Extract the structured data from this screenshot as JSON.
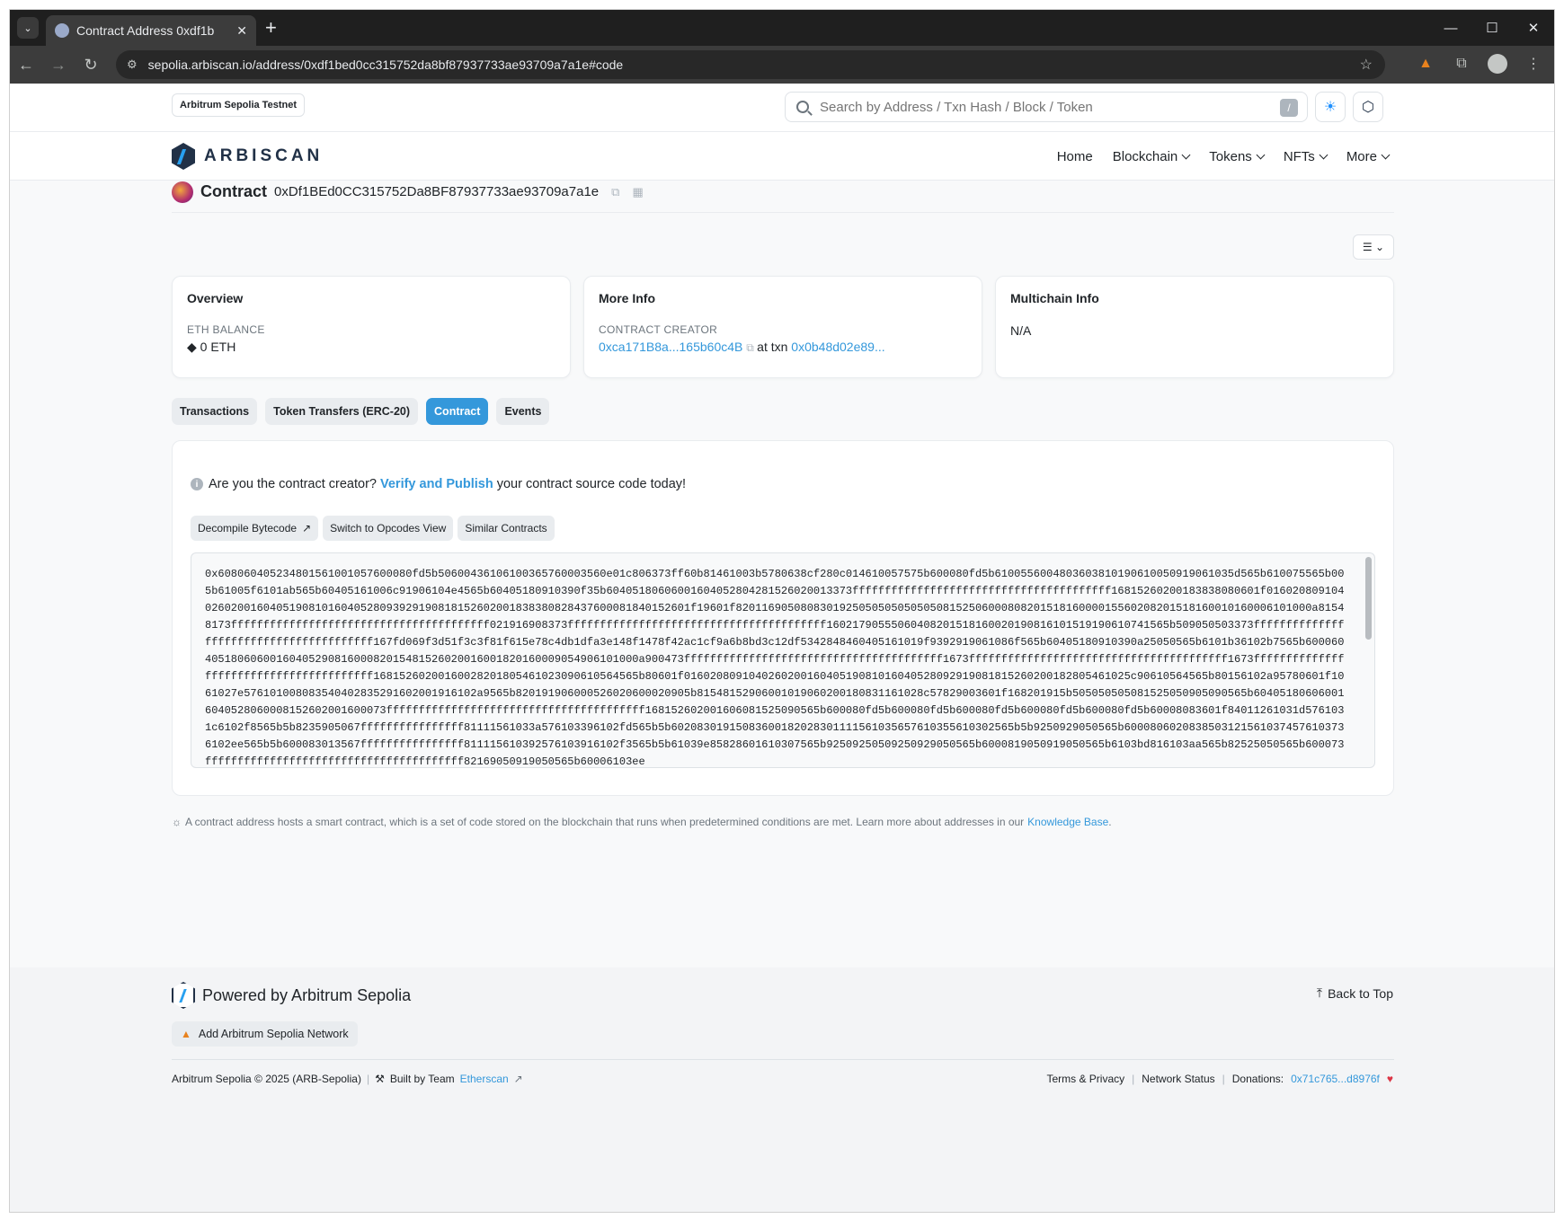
{
  "browser": {
    "tab_title": "Contract Address 0xdf1b",
    "url": "sepolia.arbiscan.io/address/0xdf1bed0cc315752da8bf87937733ae93709a7a1e#code"
  },
  "topbar": {
    "network_badge": "Arbitrum Sepolia Testnet",
    "search_placeholder": "Search by Address / Txn Hash / Block / Token",
    "search_shortcut": "/"
  },
  "nav": {
    "logo_text": "ARBISCAN",
    "items": [
      "Home",
      "Blockchain",
      "Tokens",
      "NFTs",
      "More"
    ]
  },
  "address": {
    "label": "Contract",
    "value": "0xDf1BEd0CC315752Da8BF87937733ae93709a7a1e"
  },
  "cards": {
    "overview": {
      "title": "Overview",
      "balance_label": "ETH BALANCE",
      "balance_value": "0 ETH"
    },
    "more_info": {
      "title": "More Info",
      "creator_label": "CONTRACT CREATOR",
      "creator": "0xca171B8a...165b60c4B",
      "at_txn": "at txn",
      "txn": "0x0b48d02e89..."
    },
    "multichain": {
      "title": "Multichain Info",
      "value": "N/A"
    }
  },
  "tabs": [
    "Transactions",
    "Token Transfers (ERC-20)",
    "Contract",
    "Events"
  ],
  "active_tab": "Contract",
  "notice": {
    "prefix": "Are you the contract creator?",
    "link": "Verify and Publish",
    "suffix": "your contract source code today!"
  },
  "tools": {
    "decompile": "Decompile Bytecode",
    "opcodes": "Switch to Opcodes View",
    "similar": "Similar Contracts"
  },
  "bytecode": "0x608060405234801561001057600080fd5b5060043610610036576000356 0e01c806373ff60b81461003b5780638cf280c014610057575b600080fd5b6100556004803603810190610050919061035d565b610075565b005b61005f6101ab565b60405161006c91906104e4565b60405180910390f35b6040518060600160405280428152602001337 3ffffffffffffffffffffffffffffffffffffffff16815260200183838080601f016020809104026020016040519081016040528093929190818152602001838380828437600081840152601f19601f820116905080830192505050505050508152506000808201518160000155602082015181600101600061010 00a81548173ffffffffffffffffffffffffffffffffffffffff021916908373ffffffffffffffffffffffffffffffffffffffff16021790555060408201518160020190816101519190610741565b509050503373ffffffffffffffffffffffffffffffffffffffff167fd069f3d51f3c3f81f615e78c4db1dfa3e148f1478f42ac1cf9a6b8bd3c12df534284846040516 1019f9392919061086f565b60405180910390a25050565b6101b36102b7565b60006040518060600160405290816000820154815260200160018201600090549061010 00a900473ffffffffffffffffffffffffffffffffffffffff1673ffffffffffffffffffffffffffffffffffffffff1673ffffffffffffffffffffffffffffffffffffffff16815260200160028201805461023090610564565b80601f016020809104026020016040519081016040528092919081815260200182805461025c90610564565b80156102a95780601f1061027e5761010080835404028352916020019161 02a9565b820191906000526020600020905b815481529060010190602001808311610 28c57829003601f168201915b505050505081525050905090565b6040518060600160405280600081526020016000 73ffffffffffffffffffffffffffffffffffffffff168152602001606081525090565b600080fd5b600080fd5b600080fd5b600080fd5b600080fd5b60008083601f840112610 31d5761031c6102f8565b5b8235905067ffffffffffffffff81111561033a5761033961 02fd565b5b60208301915083600182028301111561035657610355610302565b5b9250929050565b60008060208385031215610374576103736102ee565b5b600083013567ffffffffffffffff8111156103925761039161 02f3565b5b61039e85828601610307565b9250925050925092905056 5b60008190509190505 65b6103bd816103aa565b82525050565b600073ffffffffffffffffffffffffffffffffffffffff82169050919050565b60006103ee",
  "footnote": {
    "text": "A contract address hosts a smart contract, which is a set of code stored on the blockchain that runs when predetermined conditions are met. Learn more about addresses in our",
    "link": "Knowledge Base",
    "end": "."
  },
  "footer": {
    "powered": "Powered by Arbitrum Sepolia",
    "back_to_top": "Back to Top",
    "add_network": "Add Arbitrum Sepolia Network",
    "copyright": "Arbitrum Sepolia © 2025 (ARB-Sepolia)",
    "built_by": "Built by Team",
    "etherscan": "Etherscan",
    "terms": "Terms & Privacy",
    "network_status": "Network Status",
    "donations_label": "Donations:",
    "donations_addr": "0x71c765...d8976f"
  },
  "colors": {
    "accent": "#3498db",
    "brand": "#213147",
    "heart": "#dc3545"
  }
}
